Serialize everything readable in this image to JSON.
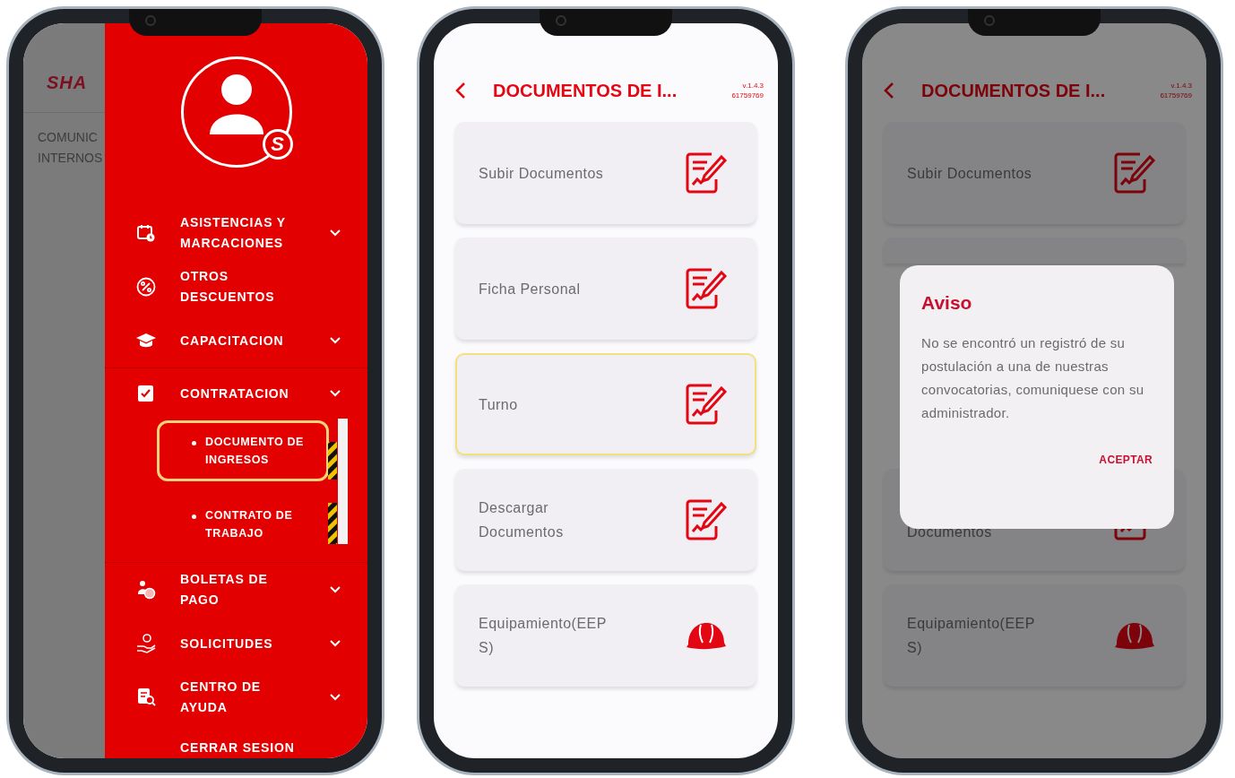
{
  "drawer_screen": {
    "background": {
      "logo": "SHA",
      "label": "COMUNIC\nINTERNOS"
    },
    "avatar_badge": "S",
    "menu": [
      {
        "kind": "expandable",
        "label": "ASISTENCIAS Y\nMARCACIONES",
        "expanded": false
      },
      {
        "kind": "link",
        "label": "OTROS\nDESCUENTOS"
      },
      {
        "kind": "expandable",
        "label": "CAPACITACION",
        "expanded": false
      },
      {
        "kind": "expandable",
        "label": "CONTRATACION",
        "expanded": true,
        "children": [
          {
            "label": "DOCUMENTO DE\nINGRESOS",
            "selected": true
          },
          {
            "label": "CONTRATO DE\nTRABAJO",
            "selected": false
          }
        ]
      },
      {
        "kind": "expandable",
        "label": "BOLETAS DE\nPAGO",
        "expanded": false
      },
      {
        "kind": "expandable",
        "label": "SOLICITUDES",
        "expanded": false
      },
      {
        "kind": "expandable",
        "label": "CENTRO DE\nAYUDA",
        "expanded": false
      },
      {
        "kind": "link",
        "label": "CERRAR SESION"
      }
    ]
  },
  "documents_screen": {
    "title": "DOCUMENTOS DE I...",
    "version": "v.1.4.3",
    "code": "61759769",
    "cards": [
      {
        "label": "Subir Documentos",
        "kind": "document",
        "selected": false
      },
      {
        "label": "Ficha Personal",
        "kind": "document",
        "selected": false
      },
      {
        "label": "Turno",
        "kind": "document",
        "selected": true
      },
      {
        "label": "Descargar\nDocumentos",
        "kind": "document",
        "selected": false
      },
      {
        "label": "Equipamiento(EEP\nS)",
        "kind": "helmet",
        "selected": false
      }
    ]
  },
  "dialog_screen": {
    "title": "DOCUMENTOS DE I...",
    "version": "v.1.4.3",
    "code": "61759769",
    "cards": [
      {
        "label": "Subir Documentos",
        "kind": "document",
        "selected": false
      },
      {
        "selected": false
      },
      {
        "label": "\nDocumentos",
        "kind": "document",
        "selected": false
      },
      {
        "label": "Equipamiento(EEP\nS)",
        "kind": "helmet",
        "selected": false
      }
    ],
    "dialog": {
      "title": "Aviso",
      "message": "No se encontró un registró de su postulación a una de nuestras convocatorias, comuniquese con su administrador.",
      "button": "ACEPTAR"
    }
  }
}
